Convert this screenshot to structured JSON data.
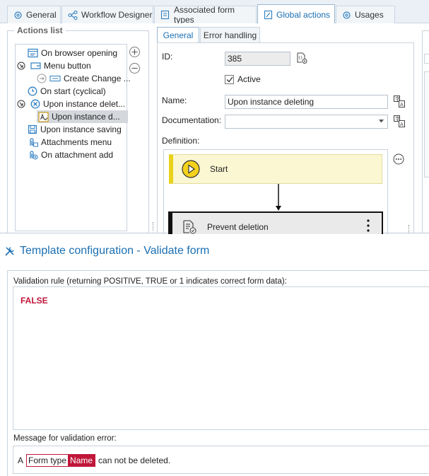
{
  "top_tabs": [
    {
      "label": "General",
      "icon": "gear-icon"
    },
    {
      "label": "Workflow Designer",
      "icon": "share-icon"
    },
    {
      "label": "Associated form types",
      "icon": "form-icon"
    },
    {
      "label": "Global actions",
      "icon": "actions-icon",
      "active": true
    },
    {
      "label": "Usages",
      "icon": "gear-icon"
    }
  ],
  "actions_list": {
    "title": "Actions list",
    "items": [
      {
        "label": "On browser opening",
        "icon": "browser-icon"
      },
      {
        "label": "Menu button",
        "icon": "menu-button-icon",
        "expander": true
      },
      {
        "label": "Create Change ...",
        "icon": "arrow-circle-icon",
        "child": true
      },
      {
        "label": "On start (cyclical)",
        "icon": "clock-icon"
      },
      {
        "label": "Upon instance delet...",
        "icon": "delete-circle-icon",
        "expander": true
      },
      {
        "label": "Upon instance d...",
        "icon": "validate-form-icon",
        "child": true,
        "selected": true
      },
      {
        "label": "Upon instance saving",
        "icon": "save-icon"
      },
      {
        "label": "Attachments menu",
        "icon": "attachment-menu-icon"
      },
      {
        "label": "On attachment add",
        "icon": "attachment-add-icon"
      }
    ]
  },
  "detail_tabs": [
    {
      "label": "General",
      "active": true
    },
    {
      "label": "Error handling"
    }
  ],
  "form": {
    "id_label": "ID:",
    "id_value": "385",
    "active_label": "Active",
    "name_label": "Name:",
    "name_value": "Upon instance deleting",
    "documentation_label": "Documentation:",
    "documentation_value": "",
    "definition_label": "Definition:"
  },
  "definition": {
    "start_label": "Start",
    "step_label": "Prevent deletion"
  },
  "template": {
    "title": "Template configuration - Validate form",
    "rule_label": "Validation rule (returning POSITIVE, TRUE or 1 indicates correct form data):",
    "rule_value": "FALSE",
    "message_label": "Message for validation error:",
    "message_prefix": "A",
    "token_form_type": "Form type",
    "token_name": "Name",
    "message_suffix": "can not be deleted."
  },
  "colors": {
    "accent": "#1a6fb3",
    "start_bg": "#fbf7d2",
    "start_bar": "#e9d21a",
    "error_red": "#c0163a"
  }
}
